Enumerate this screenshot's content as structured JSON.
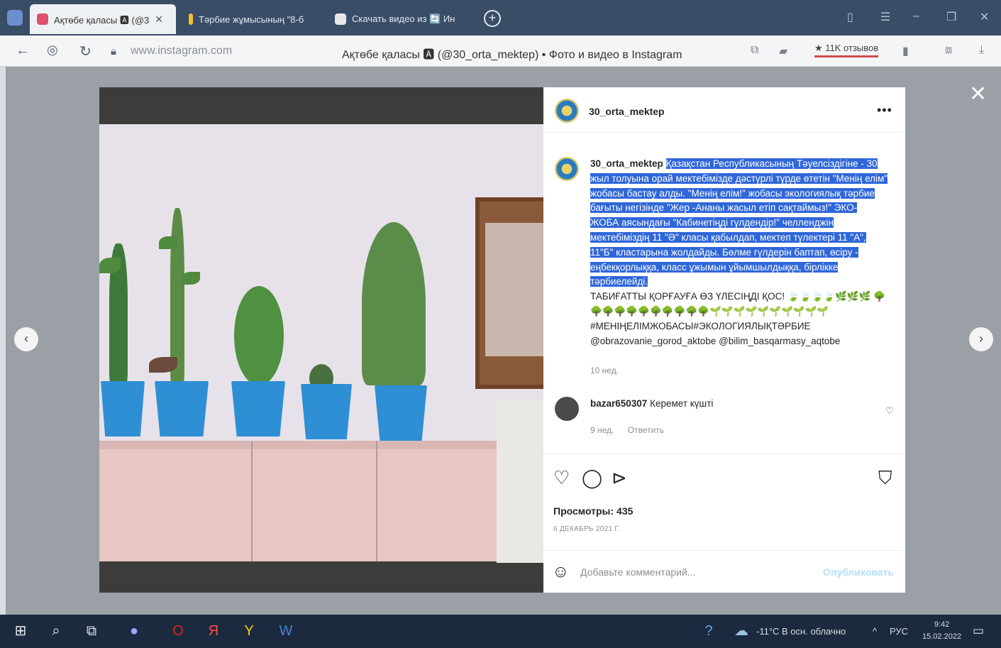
{
  "browser": {
    "tabs": [
      {
        "label": "Ақтөбе қаласы 🅰 (@3",
        "active": true,
        "color": "#e04f6f"
      },
      {
        "label": "Тәрбие жұмысының \"8-б",
        "active": false,
        "color": "#f2c230"
      },
      {
        "label": "Скачать видео из 🔄 Ин",
        "active": false,
        "color": "#e8e8e8"
      }
    ],
    "new_tab": "+",
    "url": "www.instagram.com",
    "page_title": "Ақтөбе қаласы 🅰 (@30_orta_mektep) • Фото и видео в Instagram",
    "rating": "★ 11K отзывов"
  },
  "post": {
    "username": "30_orta_mektep",
    "more": "•••",
    "caption_user": "30_orta_mektep",
    "caption_highlighted": "Қазақстан Республикасының Тәуелсіздігіне - 30 жыл толуына орай мектебімізде дәстүрлі түрде өтетін \"Менің елім\" жобасы бастау алды. \"Менің елім!\" жобасы экологиялық тәрбие бағыты негізінде \"Жер -Ананы жасыл етіп сақтаймыз!\" ЭКО- ЖОБА аясындағы \"Кабинетіңді гүлдендір!\" челленджін мектебіміздің 11 \"Ә\" класы қабылдап, мектеп түлектері 11 \"А\", 11\"Б\" кластарына жолдайды. Бөлме гүлдерін баптап, өсіру - еңбекқорлыққа, класс ұжымын ұйымшылдыққа, бірлікке тәрбиелейді.",
    "caption_rest": "ТАБИҒАТТЫ ҚОРҒАУҒА ӨЗ ҮЛЕСІҢДІ ҚОС! 🍃🍃🍃🍃🌿🌿🌿 🌳🌳🌳🌳🌳🌳🌳🌳🌳🌳🌳🌱🌱🌱🌱🌱🌱🌱🌱🌱🌱",
    "hashtags": "#МЕНІҢЕЛІМЖОБАСЫ#ЭКОЛОГИЯЛЫҚТӘРБИЕ",
    "mentions": "@obrazovanie_gorod_aktobe @bilim_basqarmasy_aqtobe",
    "time": "10 нед.",
    "comment": {
      "user": "bazar650307",
      "text": "Керемет күшті",
      "time": "9 нед.",
      "reply": "Ответить"
    },
    "views": "Просмотры: 435",
    "date": "6 ДЕКАБРЬ 2021 Г.",
    "comment_placeholder": "Добавьте комментарий...",
    "publish": "Опубликовать"
  },
  "taskbar": {
    "weather": "-11°C  В осн. облачно",
    "lang": "РУС",
    "time": "9:42",
    "date": "15.02.2022"
  },
  "colors": {
    "highlight": "#2f67d9",
    "publish": "#b2dffc",
    "pots": "#2f8fd4"
  }
}
